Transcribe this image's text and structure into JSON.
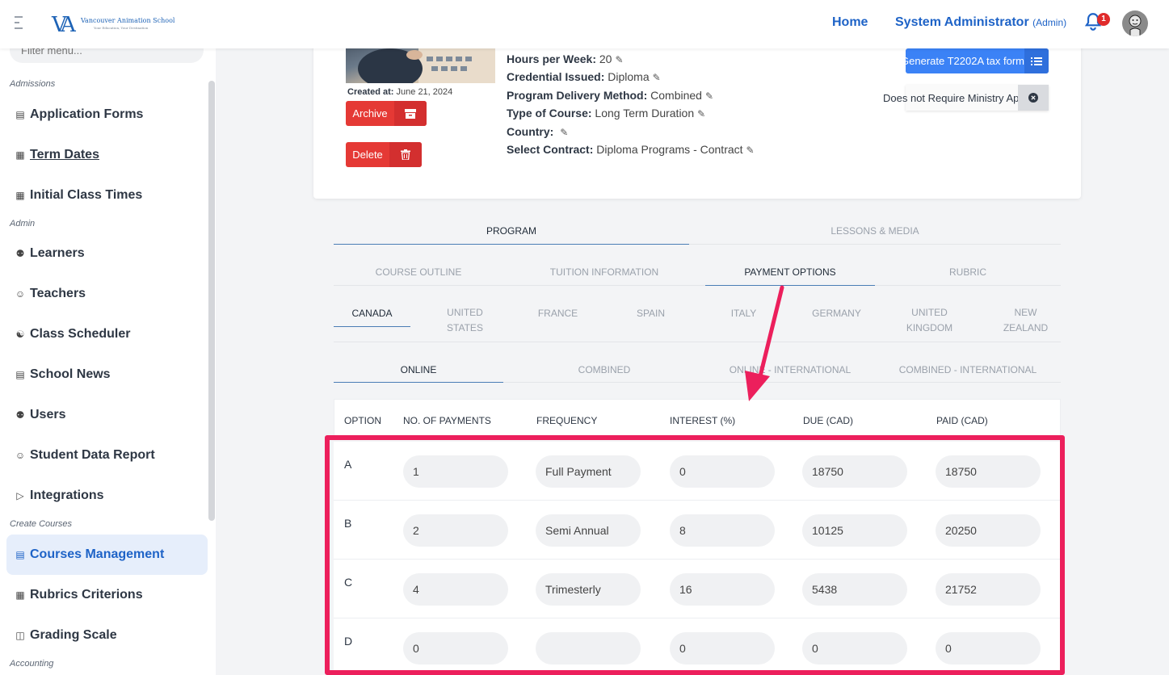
{
  "brand": {
    "logo_mark": "VA",
    "name": "Vancouver Animation School",
    "tagline": "Your Education, Your Destination"
  },
  "header": {
    "home": "Home",
    "user_name": "System Administrator",
    "user_role": "(Admin)",
    "notification_count": "1"
  },
  "sidebar": {
    "filter_placeholder": "Filter menu...",
    "sections": {
      "admissions": "Admissions",
      "admin": "Admin",
      "create_courses": "Create Courses",
      "accounting": "Accounting"
    },
    "items": [
      {
        "label": "Application Forms",
        "icon": "document-icon"
      },
      {
        "label": "Term Dates",
        "icon": "calendar-icon"
      },
      {
        "label": "Initial Class Times",
        "icon": "calendar-icon"
      },
      {
        "label": "Learners",
        "icon": "users-icon"
      },
      {
        "label": "Teachers",
        "icon": "user-icon"
      },
      {
        "label": "Class Scheduler",
        "icon": "share-icon"
      },
      {
        "label": "School News",
        "icon": "newspaper-icon"
      },
      {
        "label": "Users",
        "icon": "users-icon"
      },
      {
        "label": "Student Data Report",
        "icon": "user-icon"
      },
      {
        "label": "Integrations",
        "icon": "video-icon"
      },
      {
        "label": "Courses Management",
        "icon": "document-icon"
      },
      {
        "label": "Rubrics Criterions",
        "icon": "grid-icon"
      },
      {
        "label": "Grading Scale",
        "icon": "layout-icon"
      }
    ]
  },
  "course": {
    "created_label": "Created at:",
    "created_date": "June 21, 2024",
    "archive": "Archive",
    "delete": "Delete",
    "details": [
      {
        "label": "Hours per Week:",
        "value": "20"
      },
      {
        "label": "Credential Issued:",
        "value": "Diploma"
      },
      {
        "label": "Program Delivery Method:",
        "value": "Combined"
      },
      {
        "label": "Type of Course:",
        "value": "Long Term Duration"
      },
      {
        "label": "Country:",
        "value": ""
      },
      {
        "label": "Select Contract:",
        "value": "Diploma Programs - Contract"
      }
    ],
    "generate_button": "Generate T2202A tax form",
    "ministry_status": "Does not Require Ministry Approval"
  },
  "tabs": {
    "main": [
      "PROGRAM",
      "LESSONS & MEDIA"
    ],
    "sub": [
      "COURSE OUTLINE",
      "TUITION INFORMATION",
      "PAYMENT OPTIONS",
      "RUBRIC"
    ],
    "countries": [
      "CANADA",
      "UNITED STATES",
      "FRANCE",
      "SPAIN",
      "ITALY",
      "GERMANY",
      "UNITED KINGDOM",
      "NEW ZEALAND"
    ],
    "delivery": [
      "ONLINE",
      "COMBINED",
      "ONLINE - INTERNATIONAL",
      "COMBINED - INTERNATIONAL"
    ]
  },
  "payments": {
    "headers": [
      "OPTION",
      "NO. OF PAYMENTS",
      "FREQUENCY",
      "INTEREST (%)",
      "DUE (CAD)",
      "PAID (CAD)"
    ],
    "rows": [
      {
        "option": "A",
        "payments": "1",
        "frequency": "Full Payment",
        "interest": "0",
        "due": "18750",
        "paid": "18750"
      },
      {
        "option": "B",
        "payments": "2",
        "frequency": "Semi Annual",
        "interest": "8",
        "due": "10125",
        "paid": "20250"
      },
      {
        "option": "C",
        "payments": "4",
        "frequency": "Trimesterly",
        "interest": "16",
        "due": "5438",
        "paid": "21752"
      },
      {
        "option": "D",
        "payments": "0",
        "frequency": "",
        "interest": "0",
        "due": "0",
        "paid": "0"
      }
    ]
  },
  "colors": {
    "primary": "#1e63c7",
    "danger": "#e53935",
    "highlight": "#ec1f5c",
    "accent": "#3b82f6"
  }
}
